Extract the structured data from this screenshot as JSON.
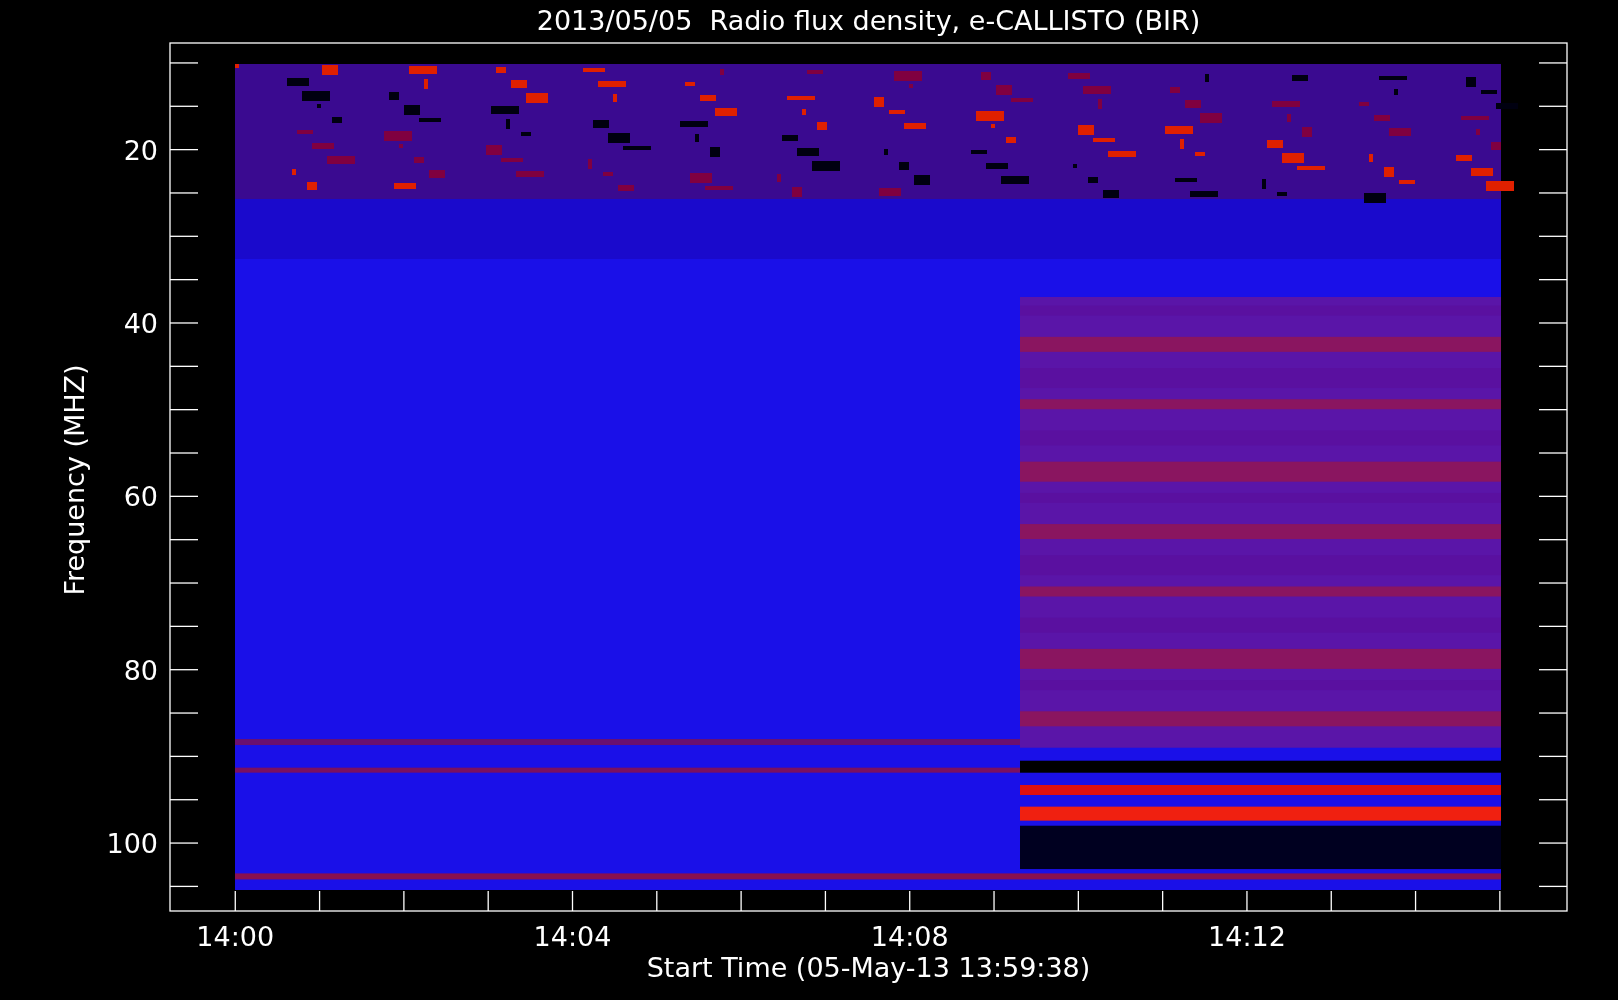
{
  "title": "2013/05/05  Radio flux density, e-CALLISTO (BIR)",
  "y_axis": {
    "label": "Frequency (MHZ)",
    "ticks": [
      "20",
      "40",
      "60",
      "80",
      "100"
    ]
  },
  "x_axis": {
    "label": "Start Time (05-May-13 13:59:38)",
    "ticks": [
      "14:00",
      "14:04",
      "14:08",
      "14:12"
    ]
  }
}
